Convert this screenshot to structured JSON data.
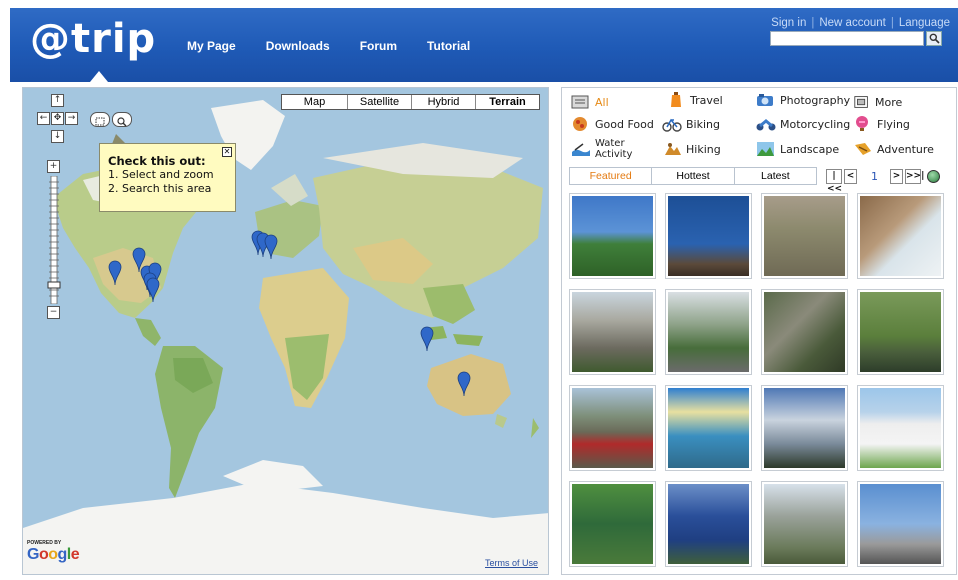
{
  "header": {
    "logo": "@trip",
    "nav": [
      "My Page",
      "Downloads",
      "Forum",
      "Tutorial"
    ],
    "top_links": [
      "Sign in",
      "New account",
      "Language"
    ],
    "search_placeholder": ""
  },
  "map": {
    "types": [
      "Map",
      "Satellite",
      "Hybrid",
      "Terrain"
    ],
    "active_type": "Terrain",
    "tooltip": {
      "title": "Check this out:",
      "line1": "1. Select and zoom",
      "line2": "2. Search this area"
    },
    "powered_by": "POWERED BY",
    "google": "Google",
    "terms": "Terms of Use"
  },
  "categories": [
    {
      "label": "All",
      "icon": "all-icon",
      "active": true
    },
    {
      "label": "Travel",
      "icon": "travel-icon"
    },
    {
      "label": "Photography",
      "icon": "photography-icon"
    },
    {
      "label": "More",
      "icon": "more-icon"
    },
    {
      "label": "Good Food",
      "icon": "food-icon"
    },
    {
      "label": "Biking",
      "icon": "bike-icon"
    },
    {
      "label": "Motorcycling",
      "icon": "motorcycle-icon"
    },
    {
      "label": "Flying",
      "icon": "balloon-icon"
    },
    {
      "label": "Water Activity",
      "icon": "water-icon"
    },
    {
      "label": "Hiking",
      "icon": "hiking-icon"
    },
    {
      "label": "Landscape",
      "icon": "landscape-icon"
    },
    {
      "label": "Adventure",
      "icon": "adventure-icon"
    }
  ],
  "tabs": [
    "Featured",
    "Hottest",
    "Latest"
  ],
  "active_tab": "Featured",
  "pager": {
    "first": "|<<",
    "prev": "<",
    "page": "1",
    "next": ">",
    "last": ">>|"
  },
  "colors": {
    "header": "#1f5ab6",
    "active": "#e68a16",
    "link": "#2a55b5"
  }
}
